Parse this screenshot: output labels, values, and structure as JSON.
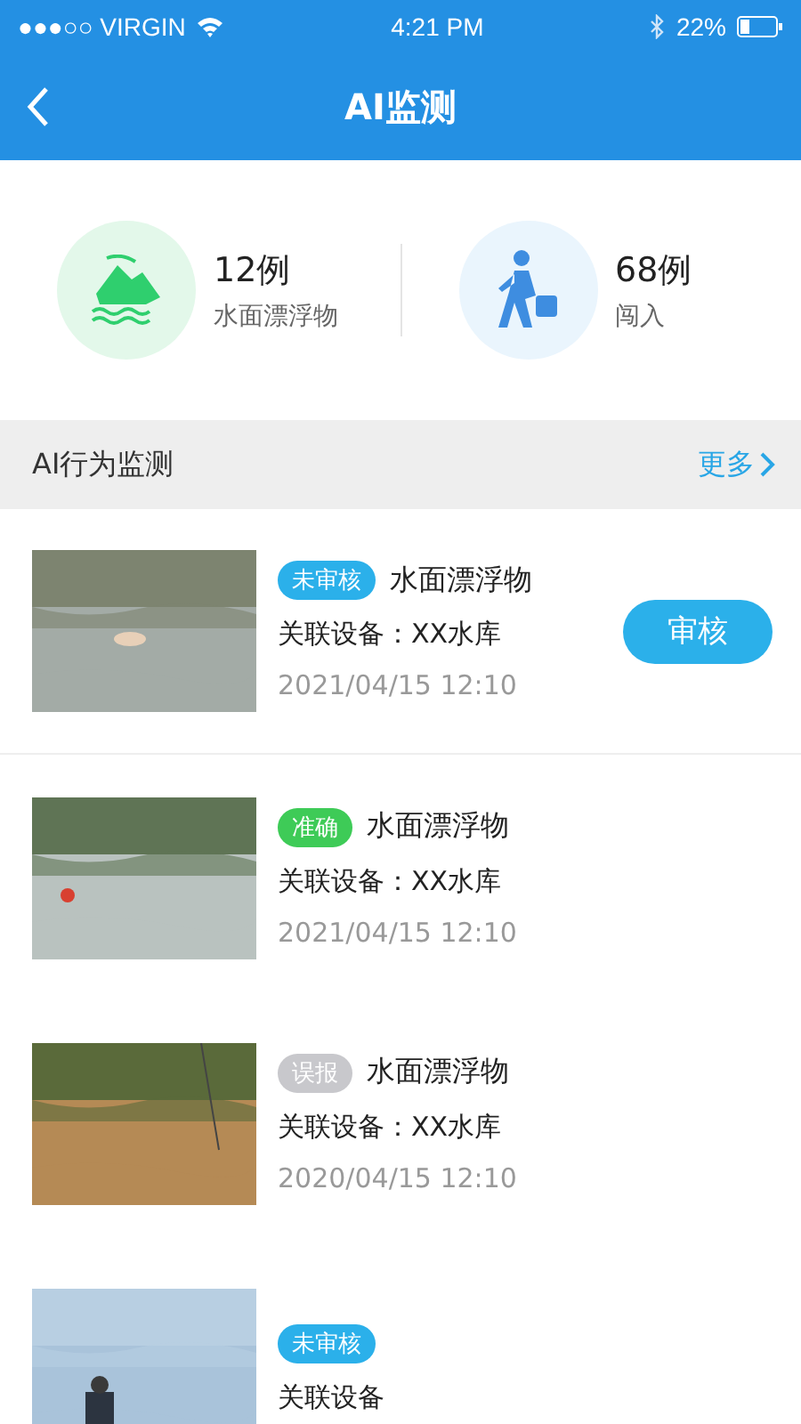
{
  "status_bar": {
    "carrier": "●●●○○ VIRGIN",
    "time": "4:21 PM",
    "battery": "22%"
  },
  "nav": {
    "title": "AI监测"
  },
  "stats": [
    {
      "kind": "floating",
      "count": "12例",
      "label": "水面漂浮物"
    },
    {
      "kind": "intrusion",
      "count": "68例",
      "label": "闯入"
    }
  ],
  "section": {
    "title": "AI行为监测",
    "more": "更多"
  },
  "items": [
    {
      "status": "未审核",
      "kind": "pending",
      "title": "水面漂浮物",
      "device": "关联设备：XX水库",
      "time": "2021/04/15 12:10",
      "action": "审核"
    },
    {
      "status": "准确",
      "kind": "accurate",
      "title": "水面漂浮物",
      "device": "关联设备：XX水库",
      "time": "2021/04/15 12:10"
    },
    {
      "status": "误报",
      "kind": "false",
      "title": "水面漂浮物",
      "device": "关联设备：XX水库",
      "time": "2020/04/15 12:10"
    },
    {
      "status": "未审核",
      "kind": "pending",
      "device": "关联设备"
    }
  ]
}
